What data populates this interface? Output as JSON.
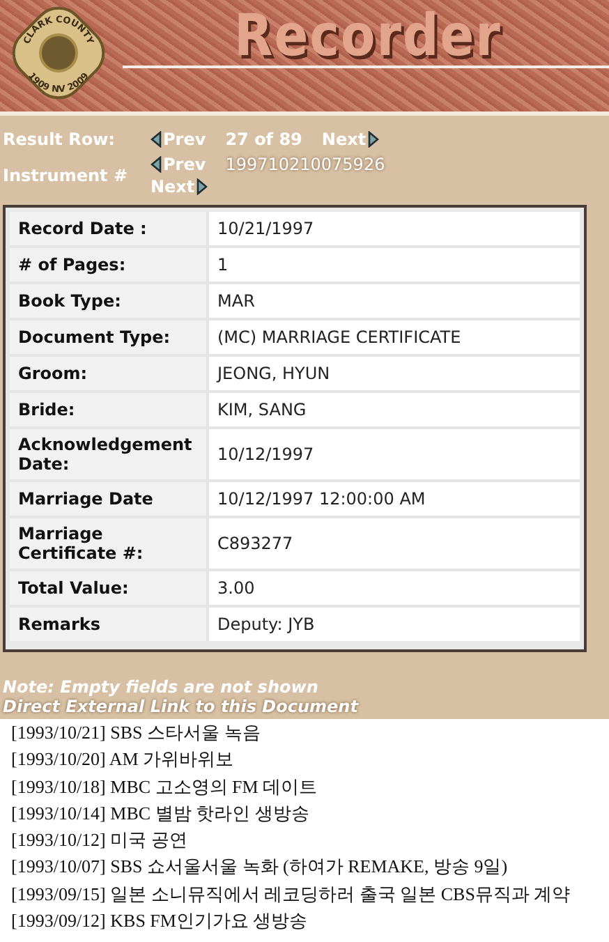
{
  "header": {
    "seal": {
      "top": "CLARK COUNTY",
      "bottom": "1909 NV 2009"
    },
    "title": "Recorder"
  },
  "result_row": {
    "label": "Result Row:",
    "prev": "Prev",
    "position": "27 of 89",
    "next": "Next"
  },
  "instrument": {
    "label": "Instrument #",
    "prev": "Prev",
    "number": "199710210075926",
    "next": "Next"
  },
  "record": [
    {
      "label": "Record Date :",
      "value": "10/21/1997"
    },
    {
      "label": "# of Pages:",
      "value": "1"
    },
    {
      "label": "Book Type:",
      "value": "MAR"
    },
    {
      "label": "Document Type:",
      "value": "(MC) MARRIAGE CERTIFICATE"
    },
    {
      "label": "Groom:",
      "value": "JEONG, HYUN"
    },
    {
      "label": "Bride:",
      "value": "KIM, SANG"
    },
    {
      "label": "Acknowledgement Date:",
      "value": "10/12/1997"
    },
    {
      "label": "Marriage Date",
      "value": "10/12/1997 12:00:00 AM"
    },
    {
      "label": "Marriage Certificate #:",
      "value": "C893277"
    },
    {
      "label": "Total Value:",
      "value": "3.00"
    },
    {
      "label": "Remarks",
      "value": "Deputy: JYB"
    }
  ],
  "note": "Note: Empty fields are not shown",
  "external_link": "Direct External Link to this Document",
  "schedule": [
    "[1993/10/21] SBS 스타서울 녹음",
    "[1993/10/20] AM 가위바위보",
    "[1993/10/18] MBC 고소영의 FM 데이트",
    "[1993/10/14] MBC 별밤 핫라인 생방송",
    "[1993/10/12] 미국 공연",
    "[1993/10/07] SBS 쇼서울서울 녹화 (하여가 REMAKE, 방송 9일)",
    "[1993/09/15] 일본 소니뮤직에서 레코딩하러 출국 일본 CBS뮤직과 계약",
    "[1993/09/12] KBS FM인기가요 생방송"
  ]
}
